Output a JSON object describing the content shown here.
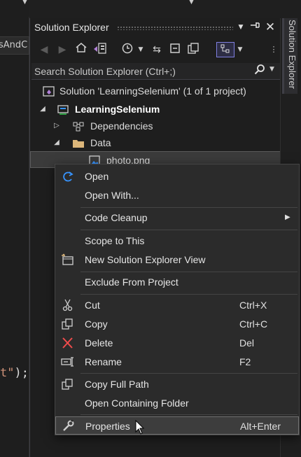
{
  "editor": {
    "crumb_text": "sAndC",
    "code_string": "t\"",
    "code_punct": ");"
  },
  "panel": {
    "title": "Solution Explorer",
    "side_tab": "Solution Explorer"
  },
  "search": {
    "placeholder": "Search Solution Explorer (Ctrl+;)"
  },
  "tree": {
    "solution": "Solution 'LearningSelenium' (1 of 1 project)",
    "project": "LearningSelenium",
    "dependencies": "Dependencies",
    "data_folder": "Data",
    "file": "photo.png"
  },
  "menu": {
    "open": "Open",
    "open_with": "Open With...",
    "code_cleanup": "Code Cleanup",
    "scope_to_this": "Scope to This",
    "new_view": "New Solution Explorer View",
    "exclude": "Exclude From Project",
    "cut": "Cut",
    "cut_key": "Ctrl+X",
    "copy": "Copy",
    "copy_key": "Ctrl+C",
    "delete": "Delete",
    "delete_key": "Del",
    "rename": "Rename",
    "rename_key": "F2",
    "copy_full_path": "Copy Full Path",
    "open_folder": "Open Containing Folder",
    "properties": "Properties",
    "properties_key": "Alt+Enter"
  },
  "colors": {
    "background": "#1f1f1f",
    "menu_bg": "#2b2b2b",
    "accent_blue": "#3794ff",
    "delete_red": "#f14c4c",
    "project_purple": "#b180d7"
  }
}
